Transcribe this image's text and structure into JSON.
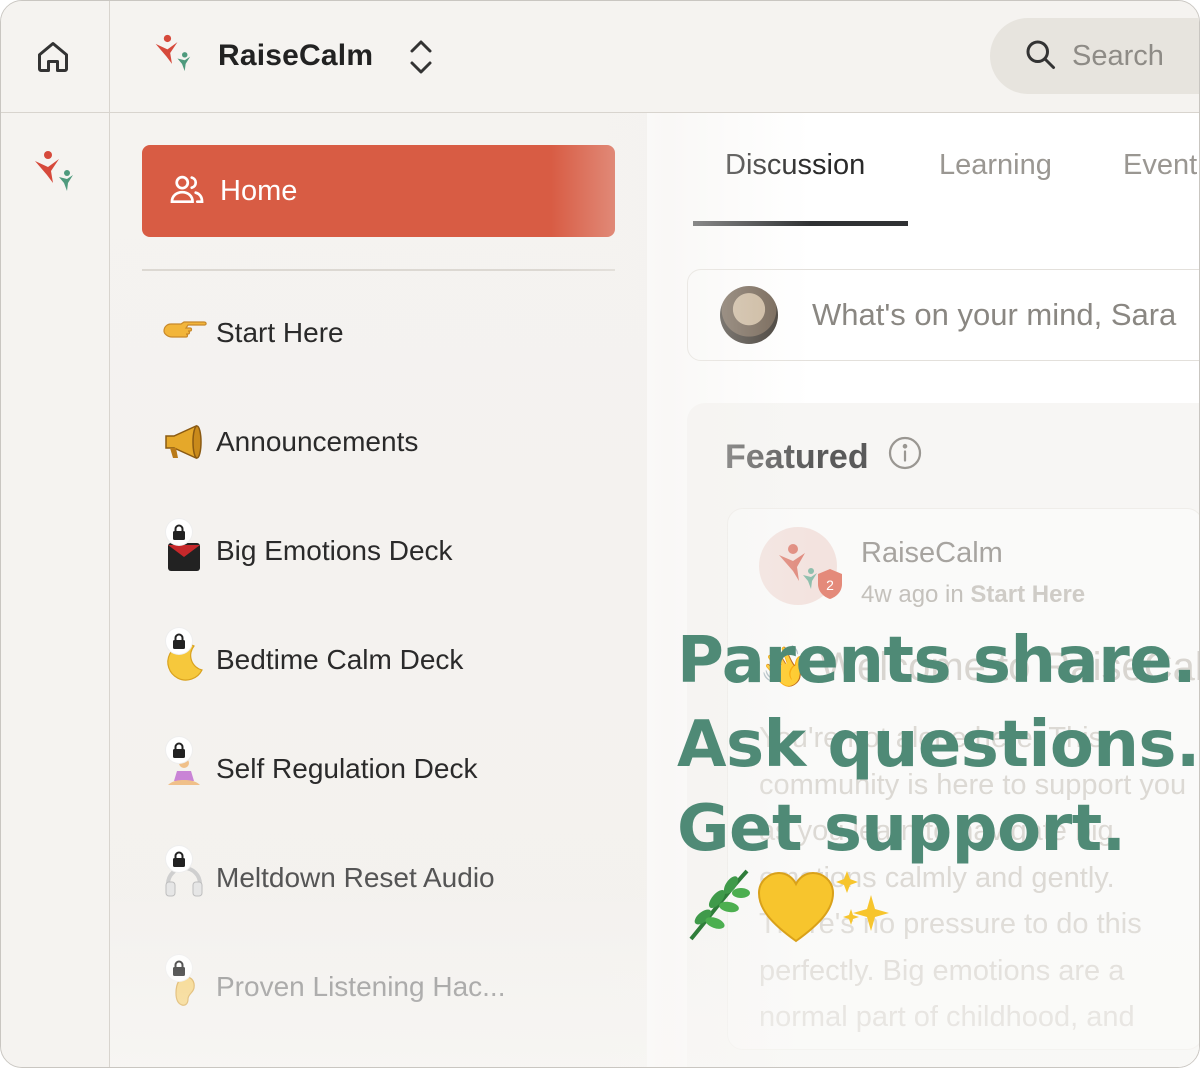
{
  "colors": {
    "accent": "#d85c44",
    "overlay_text": "#4f8a76",
    "logo_red": "#d6493b",
    "logo_green": "#4e9a7d"
  },
  "app": {
    "name": "RaiseCalm"
  },
  "search": {
    "label": "Search"
  },
  "sidebar": {
    "home": {
      "label": "Home",
      "icon": "people-icon"
    },
    "items": [
      {
        "label": "Start Here",
        "icon": "pointing-hand-icon",
        "locked": false
      },
      {
        "label": "Announcements",
        "icon": "megaphone-icon",
        "locked": false
      },
      {
        "label": "Big Emotions Deck",
        "icon": "envelope-icon",
        "locked": true
      },
      {
        "label": "Bedtime Calm Deck",
        "icon": "crescent-moon-icon",
        "locked": true
      },
      {
        "label": "Self Regulation Deck",
        "icon": "meditation-icon",
        "locked": true
      },
      {
        "label": "Meltdown Reset Audio",
        "icon": "headphones-icon",
        "locked": true
      },
      {
        "label": "Proven Listening Hac...",
        "icon": "ear-icon",
        "locked": true
      }
    ]
  },
  "tabs": [
    {
      "label": "Discussion",
      "active": true
    },
    {
      "label": "Learning",
      "active": false
    },
    {
      "label": "Event",
      "active": false
    }
  ],
  "composer": {
    "placeholder": "What's on your mind, Sara"
  },
  "featured": {
    "title": "Featured",
    "post": {
      "author": "RaiseCalm",
      "badge_count": "2",
      "time": "4w ago in",
      "space": "Start Here",
      "title": "👋 Welcome to RaiseCalm",
      "body": "You're not alone here. This community is here to support you as you learn to navigate big emotions calmly and gently. There's no pressure to do this perfectly. Big emotions are a normal part of childhood, and learning takes time"
    }
  },
  "overlay": {
    "lines": [
      "Parents share.",
      "Ask questions.",
      "Get support."
    ],
    "emoji": "🌿💛✨"
  }
}
